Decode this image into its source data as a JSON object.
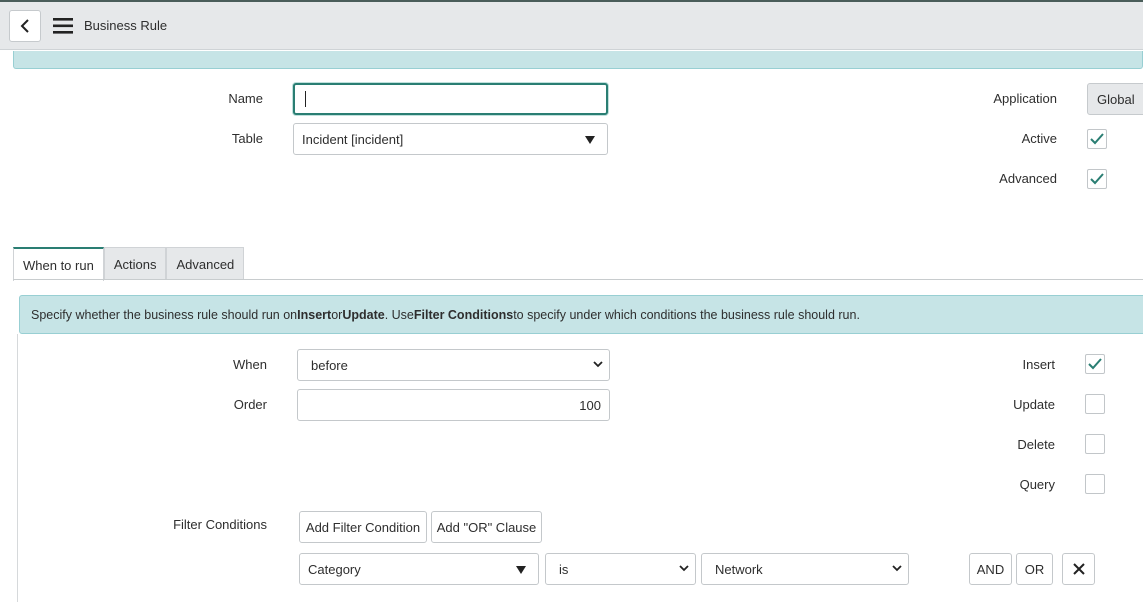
{
  "header": {
    "title": "Business Rule"
  },
  "form": {
    "name_label": "Name",
    "name_value": "",
    "table_label": "Table",
    "table_value": "Incident [incident]",
    "application_label": "Application",
    "application_value": "Global",
    "active_label": "Active",
    "active_checked": true,
    "advanced_label": "Advanced",
    "advanced_checked": true
  },
  "tabs": [
    {
      "label": "When to run",
      "active": true
    },
    {
      "label": "Actions",
      "active": false
    },
    {
      "label": "Advanced",
      "active": false
    }
  ],
  "info": {
    "part1": "Specify whether the business rule should run on ",
    "insert": "Insert",
    "or": " or ",
    "update": "Update",
    "part2": ". Use ",
    "filter_conditions": "Filter Conditions",
    "part3": " to specify under which conditions the business rule should run."
  },
  "when_to_run": {
    "when_label": "When",
    "when_value": "before",
    "order_label": "Order",
    "order_value": "100",
    "insert_label": "Insert",
    "insert_checked": true,
    "update_label": "Update",
    "update_checked": false,
    "delete_label": "Delete",
    "delete_checked": false,
    "query_label": "Query",
    "query_checked": false
  },
  "filter": {
    "label": "Filter Conditions",
    "add_condition": "Add Filter Condition",
    "add_or": "Add \"OR\" Clause",
    "field_value": "Category",
    "operator_value": "is",
    "value_value": "Network",
    "and_label": "AND",
    "or_label": "OR"
  },
  "colors": {
    "accent": "#2a7e73",
    "info_bg": "#c6e4e6",
    "header_bg": "#e6e8ea"
  }
}
